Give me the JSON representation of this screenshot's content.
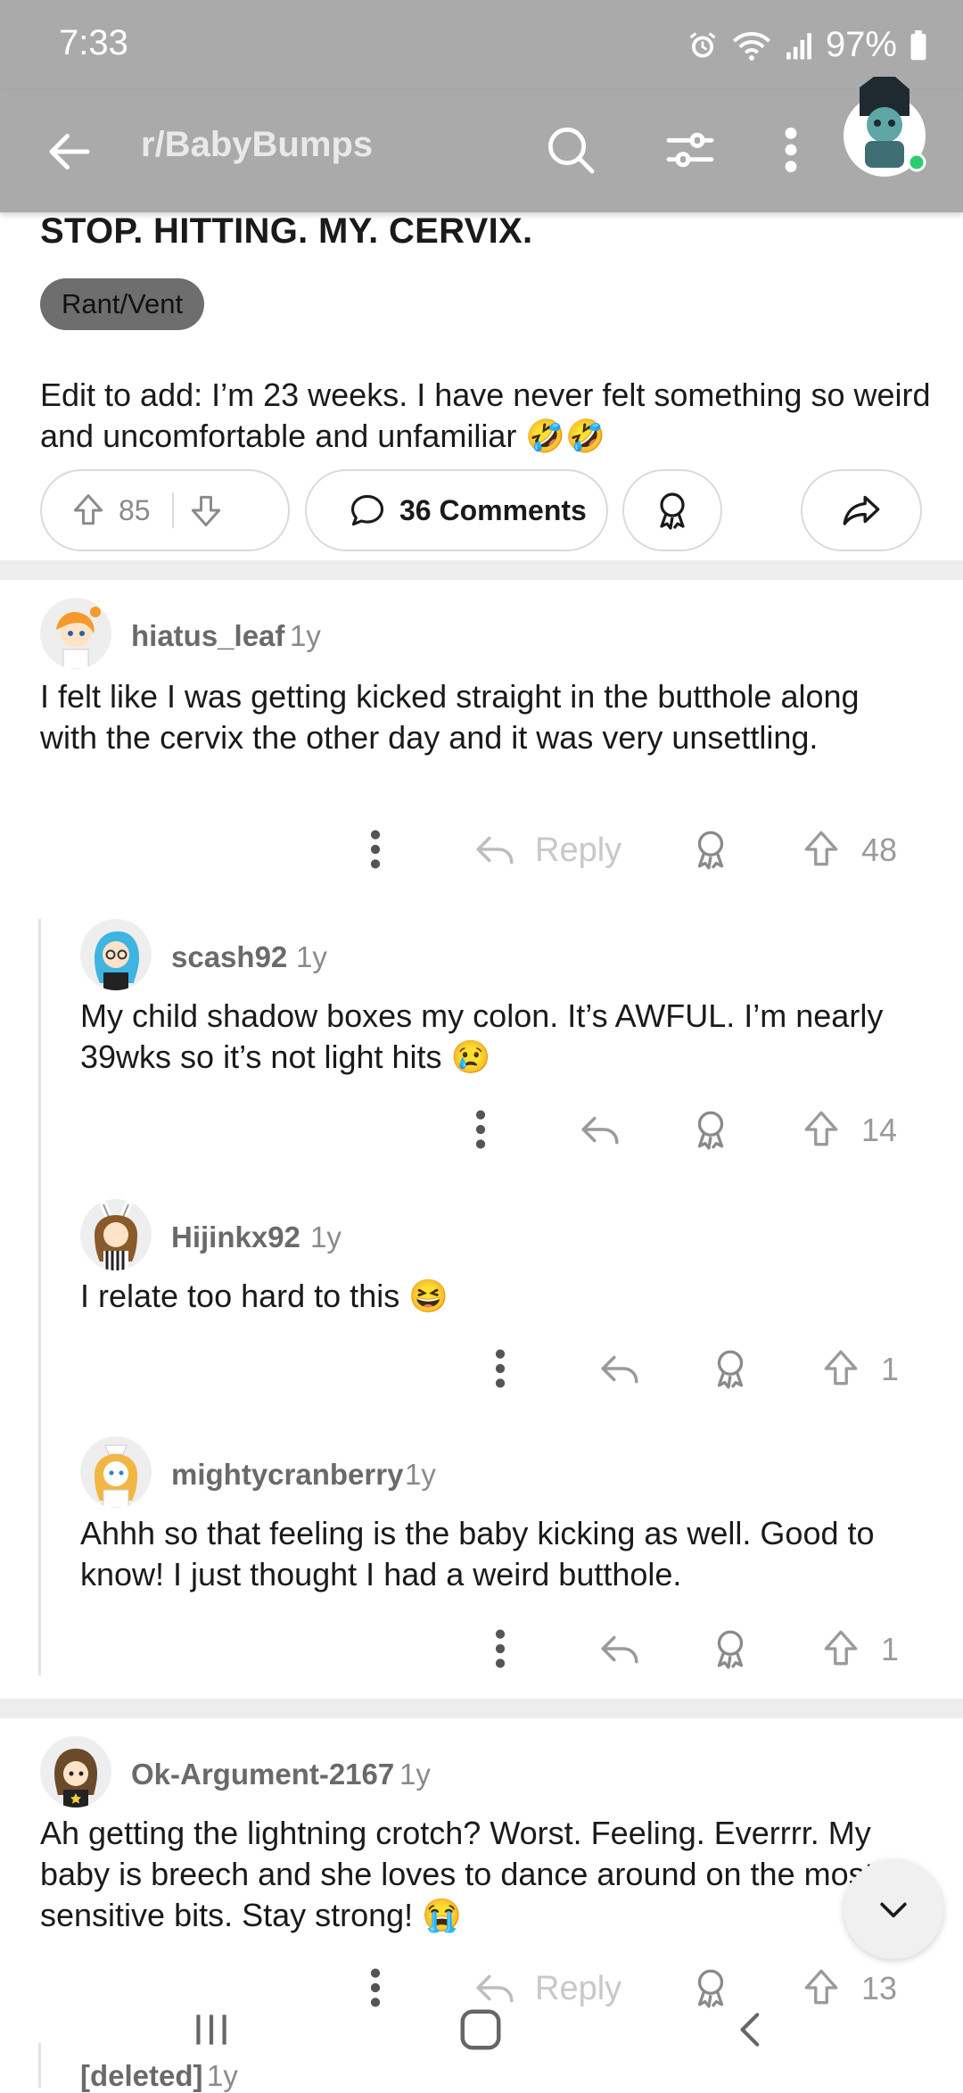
{
  "status_bar": {
    "time": "7:33",
    "battery": "97%"
  },
  "topbar": {
    "subreddit": "r/BabyBumps"
  },
  "post": {
    "title": "STOP. HITTING. MY. CERVIX.",
    "flair": "Rant/Vent",
    "body": "Edit to add: I’m 23 weeks. I have never felt something so weird and uncomfortable and unfamiliar 🤣🤣",
    "votes": "85",
    "comments_label": "36 Comments"
  },
  "comments": [
    {
      "username": "hiatus_leaf",
      "age": "1y",
      "body": "I felt like I was getting kicked straight in the butthole along with the cervix the other day and it was very unsettling.",
      "reply_label": "Reply",
      "votes": "48"
    },
    {
      "username": "scash92",
      "age": "1y",
      "body": "My child shadow boxes my colon. It’s AWFUL. I’m nearly 39wks so it’s not light hits 😢",
      "votes": "14"
    },
    {
      "username": "Hijinkx92",
      "age": "1y",
      "body": "I relate too hard to this 😆",
      "votes": "1"
    },
    {
      "username": "mightycranberry",
      "age": "1y",
      "body": "Ahhh so that feeling is the baby kicking as well. Good to know! I just thought I had a weird butthole.",
      "votes": "1"
    },
    {
      "username": "Ok-Argument-2167",
      "age": "1y",
      "body": "Ah getting the lightning crotch? Worst. Feeling. Everrrr. My baby is breech and she loves to dance around on the most sensitive bits. Stay strong! 😭",
      "reply_label": "Reply",
      "votes": "13"
    },
    {
      "username": "[deleted]",
      "age": "1y"
    }
  ],
  "icons": {
    "back": "arrow-left-icon",
    "search": "search-icon",
    "filter": "sort-filter-icon",
    "more": "kebab-icon",
    "upvote": "upvote-arrow-icon",
    "downvote": "downvote-arrow-icon",
    "comment": "speech-bubble-icon",
    "award": "award-ribbon-icon",
    "share": "share-arrow-icon",
    "reply": "reply-arrow-icon",
    "scroll_down": "chevron-down-icon"
  },
  "colors": {
    "topbar": "#aaaaaa",
    "online_dot": "#2ecc71",
    "separator": "#ededed"
  }
}
